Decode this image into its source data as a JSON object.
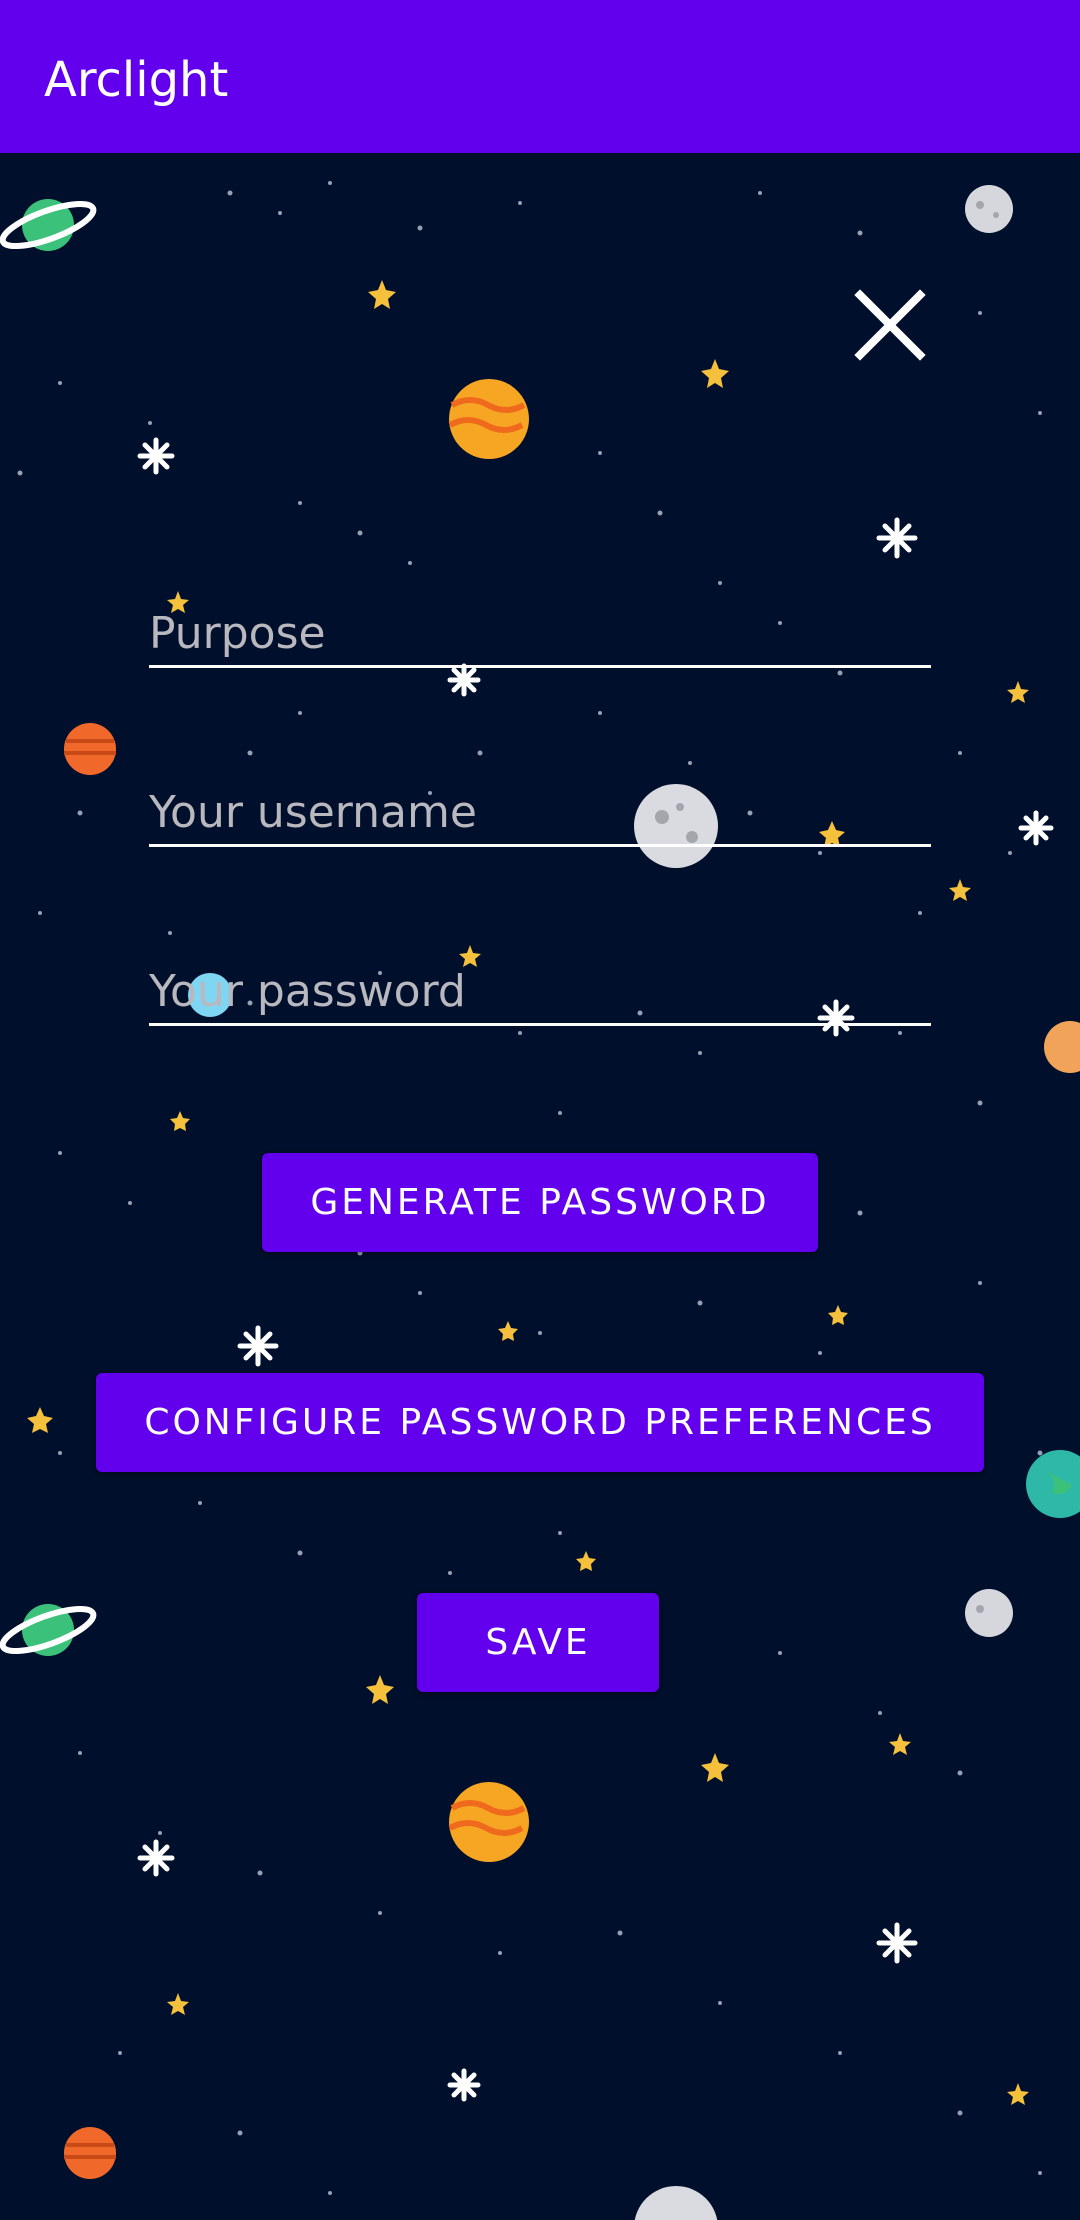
{
  "app": {
    "title": "Arclight"
  },
  "form": {
    "purpose_placeholder": "Purpose",
    "purpose_value": "",
    "username_placeholder": "Your username",
    "username_value": "",
    "password_placeholder": "Your password",
    "password_value": ""
  },
  "buttons": {
    "generate": "GENERATE PASSWORD",
    "configure": "CONFIGURE PASSWORD PREFERENCES",
    "save": "SAVE"
  },
  "icons": {
    "close": "close-icon"
  },
  "colors": {
    "primary": "#6200EE",
    "background": "#000F2B",
    "text": "#FFFFFF",
    "hint": "#B8B8BE"
  }
}
